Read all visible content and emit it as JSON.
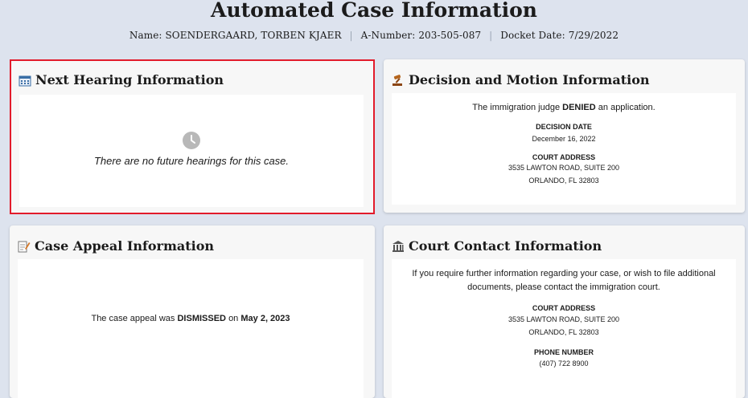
{
  "header": {
    "title": "Automated Case Information",
    "name_label": "Name:",
    "name_value": "SOENDERGAARD, TORBEN KJAER",
    "anumber_label": "A-Number:",
    "anumber_value": "203-505-087",
    "docket_label": "Docket Date:",
    "docket_value": "7/29/2022"
  },
  "next_hearing": {
    "title": "Next Hearing Information",
    "icon": "calendar-icon",
    "empty_icon": "clock-icon",
    "message": "There are no future hearings for this case."
  },
  "decision": {
    "title": "Decision and Motion Information",
    "icon": "gavel-icon",
    "text_before": "The immigration judge",
    "text_bold": "DENIED",
    "text_after": "an application.",
    "date_label": "DECISION DATE",
    "date_value": "December 16, 2022",
    "address_label": "COURT ADDRESS",
    "address_line1": "3535 LAWTON ROAD, SUITE 200",
    "address_line2": "ORLANDO, FL 32803"
  },
  "appeal": {
    "title": "Case Appeal Information",
    "icon": "edit-document-icon",
    "text_before": "The case appeal was",
    "status": "DISMISSED",
    "text_mid": "on",
    "date": "May 2, 2023"
  },
  "court_contact": {
    "title": "Court Contact Information",
    "icon": "courthouse-icon",
    "intro_line1": "If you require further information regarding your case, or wish to file additional",
    "intro_line2": "documents, please contact the immigration court.",
    "address_label": "COURT ADDRESS",
    "address_line1": "3535 LAWTON ROAD, SUITE 200",
    "address_line2": "ORLANDO, FL 32803",
    "phone_label": "PHONE NUMBER",
    "phone_value": "(407) 722 8900"
  }
}
